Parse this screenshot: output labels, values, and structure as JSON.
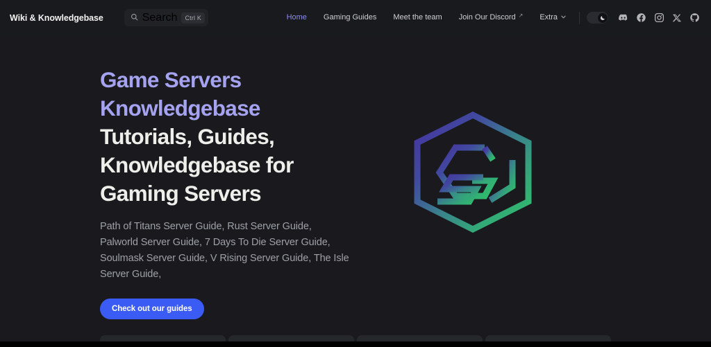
{
  "header": {
    "brand": "Wiki & Knowledgebase",
    "search": {
      "label": "Search",
      "placeholder": "Search",
      "shortcut": "Ctrl K",
      "icon": "search-icon"
    },
    "nav": [
      {
        "label": "Home",
        "active": true,
        "icon": null
      },
      {
        "label": "Gaming Guides",
        "active": false,
        "icon": null
      },
      {
        "label": "Meet the team",
        "active": false,
        "icon": null
      },
      {
        "label": "Join Our Discord",
        "active": false,
        "icon": "external-link-icon"
      },
      {
        "label": "Extra",
        "active": false,
        "icon": "chevron-down-icon"
      }
    ],
    "theme_toggle": {
      "state": "dark",
      "icon": "moon-icon"
    },
    "socials": [
      {
        "name": "discord-icon",
        "label": "Discord"
      },
      {
        "name": "facebook-icon",
        "label": "Facebook"
      },
      {
        "name": "instagram-icon",
        "label": "Instagram"
      },
      {
        "name": "x-icon",
        "label": "X"
      },
      {
        "name": "github-icon",
        "label": "GitHub"
      }
    ]
  },
  "hero": {
    "title_accent_line1": "Game Servers",
    "title_accent_line2": "Knowledgebase",
    "title_line3": "Tutorials, Guides,",
    "title_line4": "Knowledgebase for",
    "title_line5": "Gaming Servers",
    "subtitle": "Path of Titans Server Guide, Rust Server Guide, Palworld Server Guide, 7 Days To Die Server Guide, Soulmask Server Guide, V Rising Server Guide, The Isle Server Guide,",
    "cta_label": "Check out our guides",
    "logo": {
      "name": "gsk-hexagon-logo",
      "gradient_from": "#4a3a9e",
      "gradient_to": "#2fb56a"
    }
  },
  "colors": {
    "page_background": "#1a1a1e",
    "header_background": "#191a1d",
    "accent_purple": "#a5a3f0",
    "nav_active": "#8b8bf5",
    "cta_blue": "#3b5bf5",
    "heading_white": "#eeeeea",
    "body_text": "#9ea0a8",
    "card_background": "#26272b"
  },
  "cards_preview": [
    {
      "name": "card-1"
    },
    {
      "name": "card-2"
    },
    {
      "name": "card-3"
    },
    {
      "name": "card-4"
    }
  ]
}
